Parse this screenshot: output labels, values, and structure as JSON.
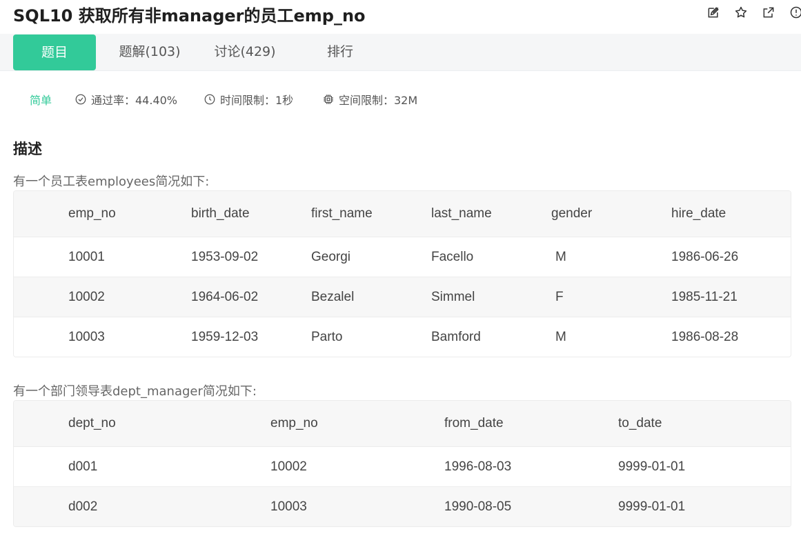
{
  "header": {
    "title": "SQL10  获取所有非manager的员工emp_no",
    "icons": [
      "edit-icon",
      "star-icon",
      "external-link-icon",
      "report-icon"
    ]
  },
  "tabs": [
    {
      "label": "题目",
      "active": true
    },
    {
      "label": "题解(103)",
      "active": false
    },
    {
      "label": "讨论(429)",
      "active": false
    },
    {
      "label": "排行",
      "active": false
    }
  ],
  "meta": {
    "difficulty": "简单",
    "pass_rate": "通过率：44.40%",
    "time_limit": "时间限制：1秒",
    "space_limit": "空间限制：32M"
  },
  "description": {
    "heading": "描述",
    "employees_intro": "有一个员工表employees简况如下:",
    "dept_manager_intro": "有一个部门领导表dept_manager简况如下:"
  },
  "employees_table": {
    "columns": [
      "emp_no",
      "birth_date",
      "first_name",
      "last_name",
      "gender",
      "hire_date"
    ],
    "rows": [
      [
        "10001",
        "1953-09-02",
        "Georgi",
        "Facello",
        " M",
        "1986-06-26"
      ],
      [
        "10002",
        "1964-06-02",
        "Bezalel",
        "Simmel",
        " F",
        "1985-11-21"
      ],
      [
        "10003",
        "1959-12-03",
        "Parto",
        "Bamford",
        " M",
        "1986-08-28"
      ]
    ]
  },
  "dept_manager_table": {
    "columns": [
      "dept_no",
      "emp_no",
      "from_date",
      "to_date"
    ],
    "rows": [
      [
        "d001",
        "10002",
        "1996-08-03",
        "9999-01-01"
      ],
      [
        "d002",
        "10003",
        "1990-08-05",
        "9999-01-01"
      ]
    ]
  },
  "colors": {
    "accent": "#32ca99",
    "tabbar_bg": "#f5f6f7",
    "header_row_bg": "#f7f7f7"
  }
}
